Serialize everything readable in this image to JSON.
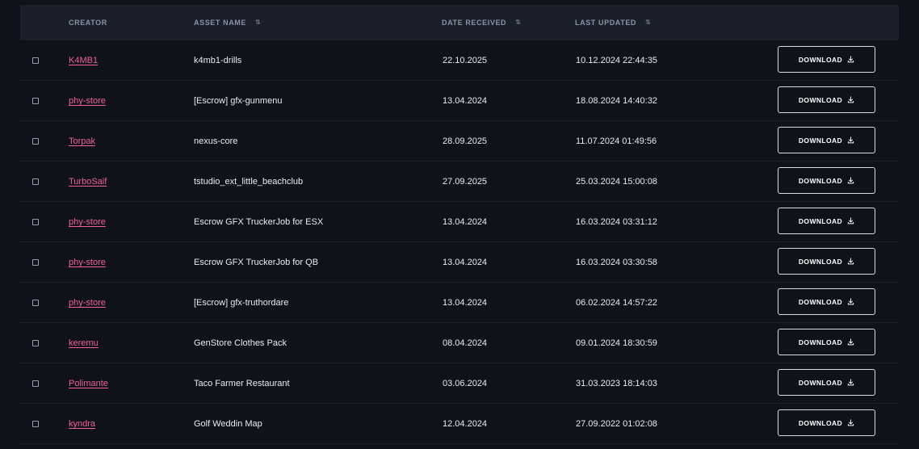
{
  "colors": {
    "background": "#0f121a",
    "header_bg": "#1b1f2a",
    "link": "#f0609a",
    "text": "#e9ebf0",
    "header_text": "#8a93a6"
  },
  "table": {
    "headers": {
      "creator": "CREATOR",
      "asset_name": "ASSET NAME",
      "date_received": "DATE RECEIVED",
      "last_updated": "LAST UPDATED"
    },
    "sort_icon": "sort-arrows-icon",
    "download_label": "DOWNLOAD",
    "download_icon": "download-icon",
    "rows": [
      {
        "creator": "K4MB1",
        "asset": "k4mb1-drills",
        "received": "22.10.2025",
        "updated": "10.12.2024 22:44:35"
      },
      {
        "creator": "phy-store",
        "asset": "[Escrow] gfx-gunmenu",
        "received": "13.04.2024",
        "updated": "18.08.2024 14:40:32"
      },
      {
        "creator": "Torpak",
        "asset": "nexus-core",
        "received": "28.09.2025",
        "updated": "11.07.2024 01:49:56"
      },
      {
        "creator": "TurboSaif",
        "asset": "tstudio_ext_little_beachclub",
        "received": "27.09.2025",
        "updated": "25.03.2024 15:00:08"
      },
      {
        "creator": "phy-store",
        "asset": "Escrow GFX TruckerJob for ESX",
        "received": "13.04.2024",
        "updated": "16.03.2024 03:31:12"
      },
      {
        "creator": "phy-store",
        "asset": "Escrow GFX TruckerJob for QB",
        "received": "13.04.2024",
        "updated": "16.03.2024 03:30:58"
      },
      {
        "creator": "phy-store",
        "asset": "[Escrow] gfx-truthordare",
        "received": "13.04.2024",
        "updated": "06.02.2024 14:57:22"
      },
      {
        "creator": "keremu",
        "asset": "GenStore Clothes Pack",
        "received": "08.04.2024",
        "updated": "09.01.2024 18:30:59"
      },
      {
        "creator": "Polimante",
        "asset": "Taco Farmer Restaurant",
        "received": "03.06.2024",
        "updated": "31.03.2023 18:14:03"
      },
      {
        "creator": "kyndra",
        "asset": "Golf Weddin Map",
        "received": "12.04.2024",
        "updated": "27.09.2022 01:02:08"
      }
    ]
  }
}
